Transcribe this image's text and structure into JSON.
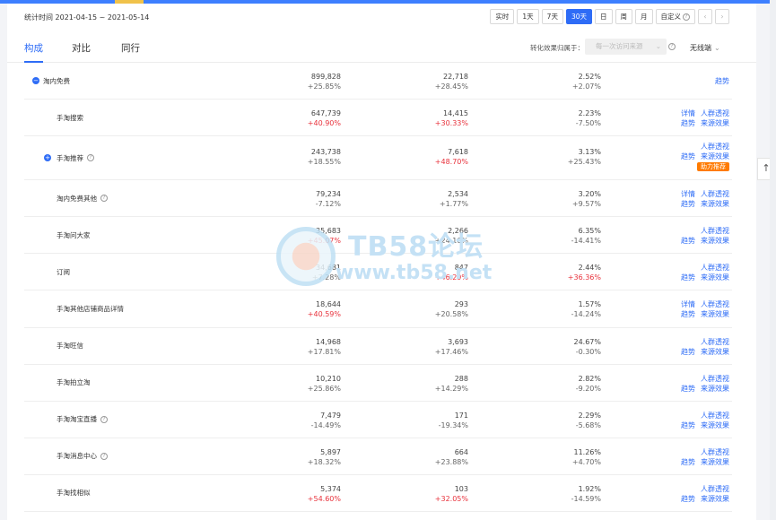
{
  "header": {
    "date_label": "统计时间 2021-04-15 ~ 2021-05-14",
    "ranges": [
      {
        "label": "实时",
        "active": false
      },
      {
        "label": "1天",
        "active": false
      },
      {
        "label": "7天",
        "active": false
      },
      {
        "label": "30天",
        "active": true
      },
      {
        "label": "日",
        "active": false
      },
      {
        "label": "周",
        "active": false
      },
      {
        "label": "月",
        "active": false
      },
      {
        "label": "自定义",
        "active": false
      }
    ],
    "prev_icon": "‹",
    "next_icon": "›"
  },
  "tabs": [
    {
      "label": "构成",
      "active": true
    },
    {
      "label": "对比",
      "active": false
    },
    {
      "label": "同行",
      "active": false
    }
  ],
  "filters": {
    "conversion_label": "转化效果归属于：",
    "conversion_value": "每一次访问来源",
    "wireless": "无线端"
  },
  "rows": [
    {
      "name": "淘内免费",
      "level": 0,
      "expand": true,
      "help": false,
      "c1": {
        "value": "899,828",
        "change": "+25.85%",
        "up": false
      },
      "c2": {
        "value": "22,718",
        "change": "+28.45%",
        "up": false
      },
      "c3": {
        "value": "2.52%",
        "change": "+2.07%",
        "up": false
      },
      "actions": [
        [
          "趋势"
        ]
      ]
    },
    {
      "name": "手淘搜索",
      "level": 1,
      "expand": false,
      "help": false,
      "c1": {
        "value": "647,739",
        "change": "+40.90%",
        "up": true
      },
      "c2": {
        "value": "14,415",
        "change": "+30.33%",
        "up": true
      },
      "c3": {
        "value": "2.23%",
        "change": "-7.50%",
        "up": false
      },
      "actions": [
        [
          "详情",
          "人群透视"
        ],
        [
          "趋势",
          "来源效果"
        ]
      ]
    },
    {
      "name": "手淘推荐",
      "level": 1,
      "expand": true,
      "help": true,
      "tall": true,
      "c1": {
        "value": "243,738",
        "change": "+18.55%",
        "up": false
      },
      "c2": {
        "value": "7,618",
        "change": "+48.70%",
        "up": true
      },
      "c3": {
        "value": "3.13%",
        "change": "+25.43%",
        "up": false
      },
      "actions": [
        [
          "人群透视"
        ],
        [
          "趋势",
          "来源效果"
        ]
      ],
      "badge": "助力推荐"
    },
    {
      "name": "淘内免费其他",
      "level": 1,
      "expand": false,
      "help": true,
      "c1": {
        "value": "79,234",
        "change": "-7.12%",
        "up": false
      },
      "c2": {
        "value": "2,534",
        "change": "+1.77%",
        "up": false
      },
      "c3": {
        "value": "3.20%",
        "change": "+9.57%",
        "up": false
      },
      "actions": [
        [
          "详情",
          "人群透视"
        ],
        [
          "趋势",
          "来源效果"
        ]
      ]
    },
    {
      "name": "手淘问大家",
      "level": 1,
      "expand": false,
      "help": false,
      "c1": {
        "value": "35,683",
        "change": "+45.07%",
        "up": true
      },
      "c2": {
        "value": "2,266",
        "change": "+24.16%",
        "up": false
      },
      "c3": {
        "value": "6.35%",
        "change": "-14.41%",
        "up": false
      },
      "actions": [
        [
          "人群透视"
        ],
        [
          "趋势",
          "来源效果"
        ]
      ]
    },
    {
      "name": "订阅",
      "level": 1,
      "expand": false,
      "help": false,
      "c1": {
        "value": "34,681",
        "change": "+7.28%",
        "up": false
      },
      "c2": {
        "value": "847",
        "change": "+46.29%",
        "up": true
      },
      "c3": {
        "value": "2.44%",
        "change": "+36.36%",
        "up": true
      },
      "actions": [
        [
          "人群透视"
        ],
        [
          "趋势",
          "来源效果"
        ]
      ]
    },
    {
      "name": "手淘其他店铺商品详情",
      "level": 1,
      "expand": false,
      "help": false,
      "c1": {
        "value": "18,644",
        "change": "+40.59%",
        "up": true
      },
      "c2": {
        "value": "293",
        "change": "+20.58%",
        "up": false
      },
      "c3": {
        "value": "1.57%",
        "change": "-14.24%",
        "up": false
      },
      "actions": [
        [
          "详情",
          "人群透视"
        ],
        [
          "趋势",
          "来源效果"
        ]
      ]
    },
    {
      "name": "手淘旺信",
      "level": 1,
      "expand": false,
      "help": false,
      "c1": {
        "value": "14,968",
        "change": "+17.81%",
        "up": false
      },
      "c2": {
        "value": "3,693",
        "change": "+17.46%",
        "up": false
      },
      "c3": {
        "value": "24.67%",
        "change": "-0.30%",
        "up": false
      },
      "actions": [
        [
          "人群透视"
        ],
        [
          "趋势",
          "来源效果"
        ]
      ]
    },
    {
      "name": "手淘拍立淘",
      "level": 1,
      "expand": false,
      "help": false,
      "c1": {
        "value": "10,210",
        "change": "+25.86%",
        "up": false
      },
      "c2": {
        "value": "288",
        "change": "+14.29%",
        "up": false
      },
      "c3": {
        "value": "2.82%",
        "change": "-9.20%",
        "up": false
      },
      "actions": [
        [
          "人群透视"
        ],
        [
          "趋势",
          "来源效果"
        ]
      ]
    },
    {
      "name": "手淘淘宝直播",
      "level": 1,
      "expand": false,
      "help": true,
      "c1": {
        "value": "7,479",
        "change": "-14.49%",
        "up": false
      },
      "c2": {
        "value": "171",
        "change": "-19.34%",
        "up": false
      },
      "c3": {
        "value": "2.29%",
        "change": "-5.68%",
        "up": false
      },
      "actions": [
        [
          "人群透视"
        ],
        [
          "趋势",
          "来源效果"
        ]
      ]
    },
    {
      "name": "手淘消息中心",
      "level": 1,
      "expand": false,
      "help": true,
      "c1": {
        "value": "5,897",
        "change": "+18.32%",
        "up": false
      },
      "c2": {
        "value": "664",
        "change": "+23.88%",
        "up": false
      },
      "c3": {
        "value": "11.26%",
        "change": "+4.70%",
        "up": false
      },
      "actions": [
        [
          "人群透视"
        ],
        [
          "趋势",
          "来源效果"
        ]
      ]
    },
    {
      "name": "手淘找相似",
      "level": 1,
      "expand": false,
      "help": false,
      "c1": {
        "value": "5,374",
        "change": "+54.60%",
        "up": true
      },
      "c2": {
        "value": "103",
        "change": "+32.05%",
        "up": true
      },
      "c3": {
        "value": "1.92%",
        "change": "-14.59%",
        "up": false
      },
      "actions": [
        [
          "人群透视"
        ],
        [
          "趋势",
          "来源效果"
        ]
      ]
    }
  ],
  "watermark": {
    "line1": "TB58论坛",
    "line2": "www.tb58.net"
  },
  "side": {
    "back_top_icon": "↑"
  },
  "colors": {
    "accent": "#2e6cf6",
    "up": "#e8323c",
    "badge": "#ff7b00"
  }
}
